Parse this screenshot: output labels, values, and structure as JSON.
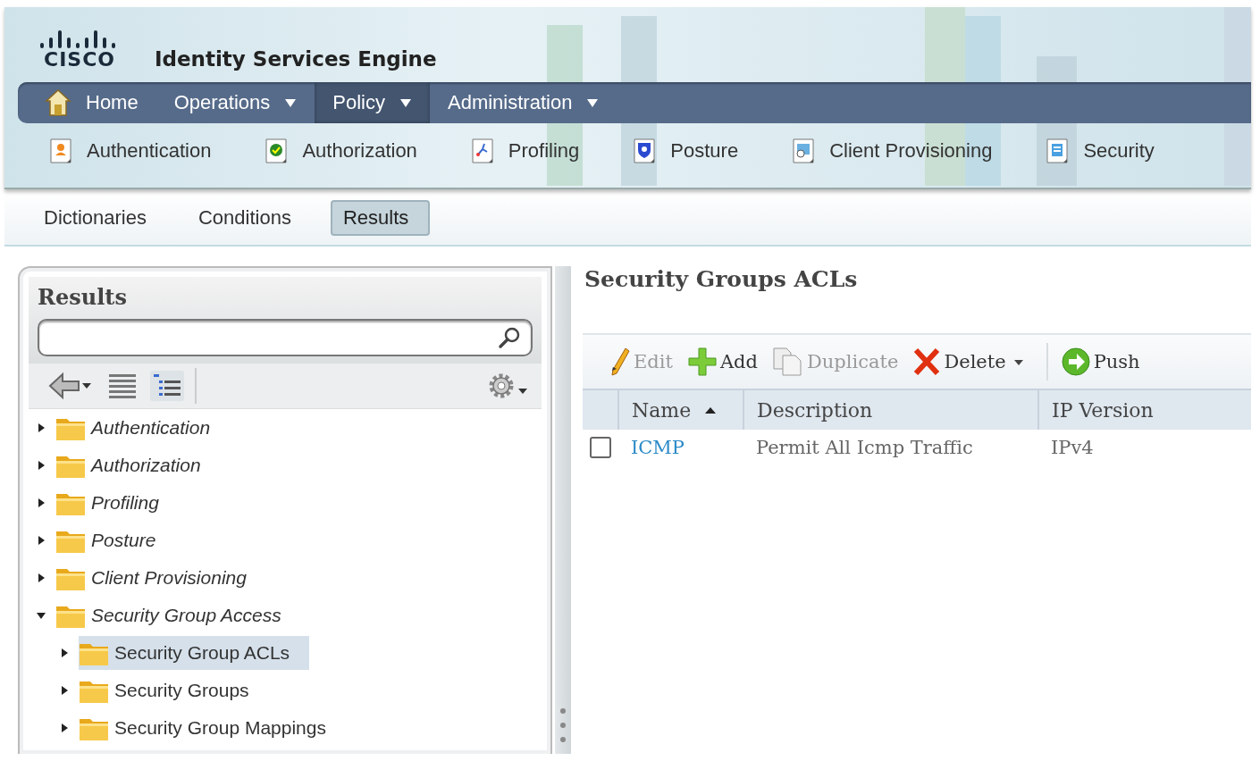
{
  "header": {
    "logo_text": "CISCO",
    "title": "Identity Services Engine"
  },
  "main_menu": [
    {
      "label": "Home",
      "kind": "home",
      "selected": false
    },
    {
      "label": "Operations",
      "kind": "dropdown",
      "selected": false
    },
    {
      "label": "Policy",
      "kind": "dropdown",
      "selected": true
    },
    {
      "label": "Administration",
      "kind": "dropdown",
      "selected": false
    }
  ],
  "sub_menu": [
    {
      "label": "Authentication",
      "kind": "authentication"
    },
    {
      "label": "Authorization",
      "kind": "authorization"
    },
    {
      "label": "Profiling",
      "kind": "profiling"
    },
    {
      "label": "Posture",
      "kind": "posture"
    },
    {
      "label": "Client Provisioning",
      "kind": "provisioning"
    },
    {
      "label": "Security",
      "kind": "security"
    }
  ],
  "tabs": [
    {
      "label": "Dictionaries",
      "selected": false
    },
    {
      "label": "Conditions",
      "selected": false
    },
    {
      "label": "Results",
      "selected": true
    }
  ],
  "results_panel": {
    "title": "Results",
    "tree": [
      {
        "label": "Authentication",
        "expanded": false,
        "selected": false
      },
      {
        "label": "Authorization",
        "expanded": false,
        "selected": false
      },
      {
        "label": "Profiling",
        "expanded": false,
        "selected": false
      },
      {
        "label": "Posture",
        "expanded": false,
        "selected": false
      },
      {
        "label": "Client Provisioning",
        "expanded": false,
        "selected": false
      },
      {
        "label": "Security Group Access",
        "expanded": true,
        "selected": false,
        "children": [
          {
            "label": "Security Group ACLs",
            "expanded": false,
            "selected": true
          },
          {
            "label": "Security Groups",
            "expanded": false,
            "selected": false
          },
          {
            "label": "Security Group Mappings",
            "expanded": false,
            "selected": false
          }
        ]
      }
    ]
  },
  "acl_panel": {
    "title": "Security Groups ACLs",
    "toolbar": [
      {
        "label": "Edit",
        "kind": "edit",
        "disabled": true
      },
      {
        "label": "Add",
        "kind": "add",
        "disabled": false
      },
      {
        "label": "Duplicate",
        "kind": "duplicate",
        "disabled": true
      },
      {
        "label": "Delete",
        "kind": "delete",
        "disabled": false
      },
      {
        "label": "Push",
        "kind": "push",
        "disabled": false
      }
    ],
    "table": {
      "columns": [
        {
          "label": "Name",
          "sorted": true
        },
        {
          "label": "Description",
          "sorted": false
        },
        {
          "label": "IP Version",
          "sorted": false
        }
      ],
      "rows": [
        {
          "checked": false,
          "cells": [
            "ICMP",
            "Permit All Icmp Traffic",
            "IPv4"
          ]
        }
      ]
    }
  }
}
